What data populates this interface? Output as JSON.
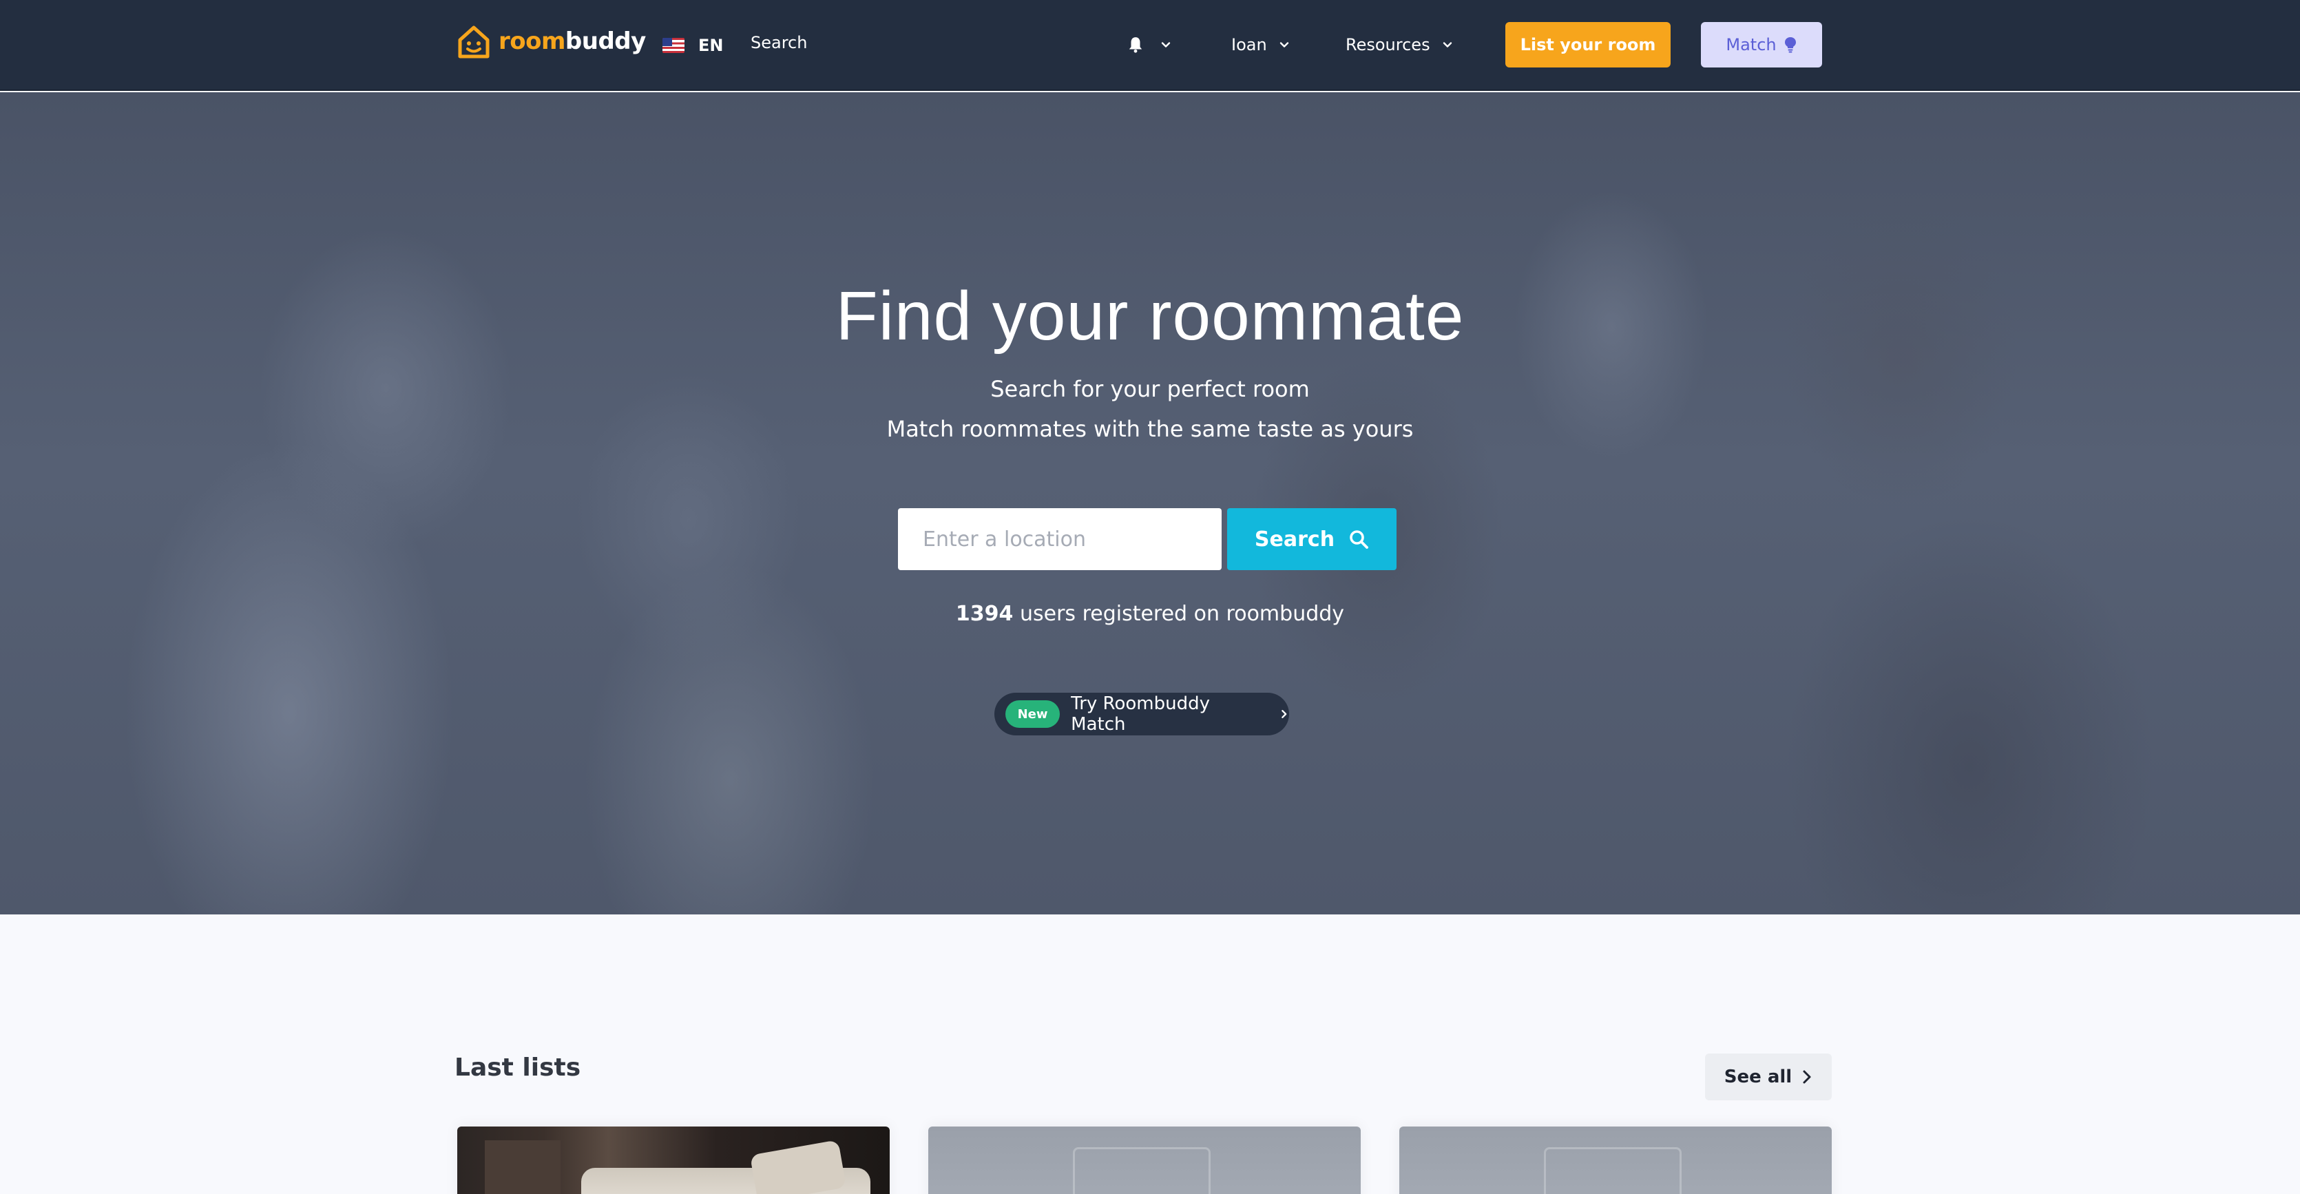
{
  "brand": {
    "name_room": "room",
    "name_buddy": "buddy",
    "accent": "#f7a51c"
  },
  "nav": {
    "lang": "EN",
    "search": "Search",
    "user": "Ioan",
    "resources": "Resources",
    "list_room": "List your room",
    "match": "Match"
  },
  "hero": {
    "title": "Find your roommate",
    "subtitle1": "Search for your perfect room",
    "subtitle2": "Match roommates with the same taste as yours",
    "location_placeholder": "Enter a location",
    "search_button": "Search",
    "users_count": "1394",
    "users_text": "users registered on roombuddy",
    "badge": "New",
    "try_match": "Try Roombuddy Match"
  },
  "last_lists": {
    "title": "Last lists",
    "see_all": "See all"
  },
  "colors": {
    "navbar": "#232e40",
    "search_button": "#12b8dc",
    "new_badge": "#27b37a",
    "match_button_bg": "#dcdcfb"
  },
  "icons": [
    "house-logo-icon",
    "us-flag-icon",
    "bell-icon",
    "chevron-down-icon",
    "lightbulb-icon",
    "search-icon",
    "chevron-right-icon"
  ]
}
